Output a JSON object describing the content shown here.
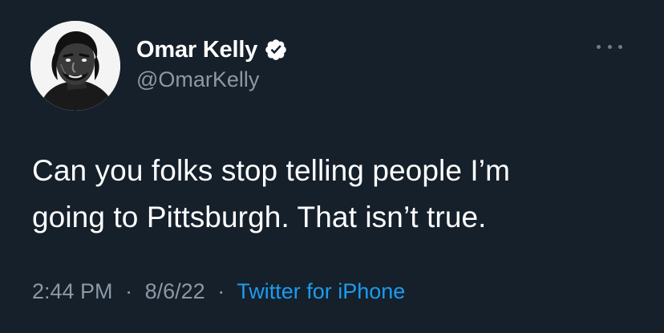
{
  "author": {
    "display_name": "Omar Kelly",
    "handle": "@OmarKelly",
    "verified": true
  },
  "tweet": {
    "line1": "Can you folks stop telling people I’m",
    "line2": "going to Pittsburgh. That isn’t true."
  },
  "meta": {
    "time": "2:44 PM",
    "date": "8/6/22",
    "source": "Twitter for iPhone",
    "separator": "·"
  },
  "colors": {
    "background": "#15202b",
    "text_primary": "#ffffff",
    "text_secondary": "#8b98a5",
    "link": "#1d9bf0",
    "verified_badge": "#ffffff"
  },
  "icons": {
    "verified": "verified-badge-icon",
    "more": "more-options-icon"
  }
}
